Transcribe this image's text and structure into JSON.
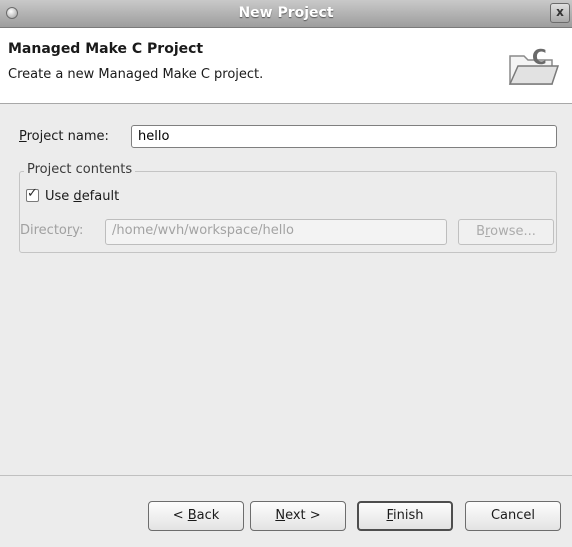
{
  "window": {
    "title": "New Project",
    "close_symbol": "x"
  },
  "banner": {
    "heading": "Managed Make C Project",
    "description": "Create a new Managed Make C project.",
    "icon": "c-project-folder-icon",
    "icon_letter": "C"
  },
  "project_name": {
    "label_mnemonic": "P",
    "label_rest": "roject name:",
    "value": "hello"
  },
  "project_contents": {
    "legend": "Project contents",
    "use_default": {
      "checked": true,
      "label_before": "Use ",
      "label_mnemonic": "d",
      "label_after": "efault"
    },
    "directory": {
      "label_before": "Directo",
      "label_mnemonic": "r",
      "label_after": "y:",
      "value": "/home/wvh/workspace/hello",
      "enabled": false
    },
    "browse": {
      "label_before": "B",
      "label_mnemonic": "r",
      "label_after": "owse..."
    }
  },
  "buttons": {
    "back": {
      "before": "< ",
      "mnemonic": "B",
      "after": "ack"
    },
    "next": {
      "before": "",
      "mnemonic": "N",
      "after": "ext >"
    },
    "finish": {
      "before": "",
      "mnemonic": "F",
      "after": "inish"
    },
    "cancel": {
      "label": "Cancel"
    }
  },
  "colors": {
    "dialog_bg": "#ececec",
    "banner_bg": "#ffffff",
    "titlebar": "#9d9d9d",
    "disabled_text": "#a0a0a0"
  }
}
